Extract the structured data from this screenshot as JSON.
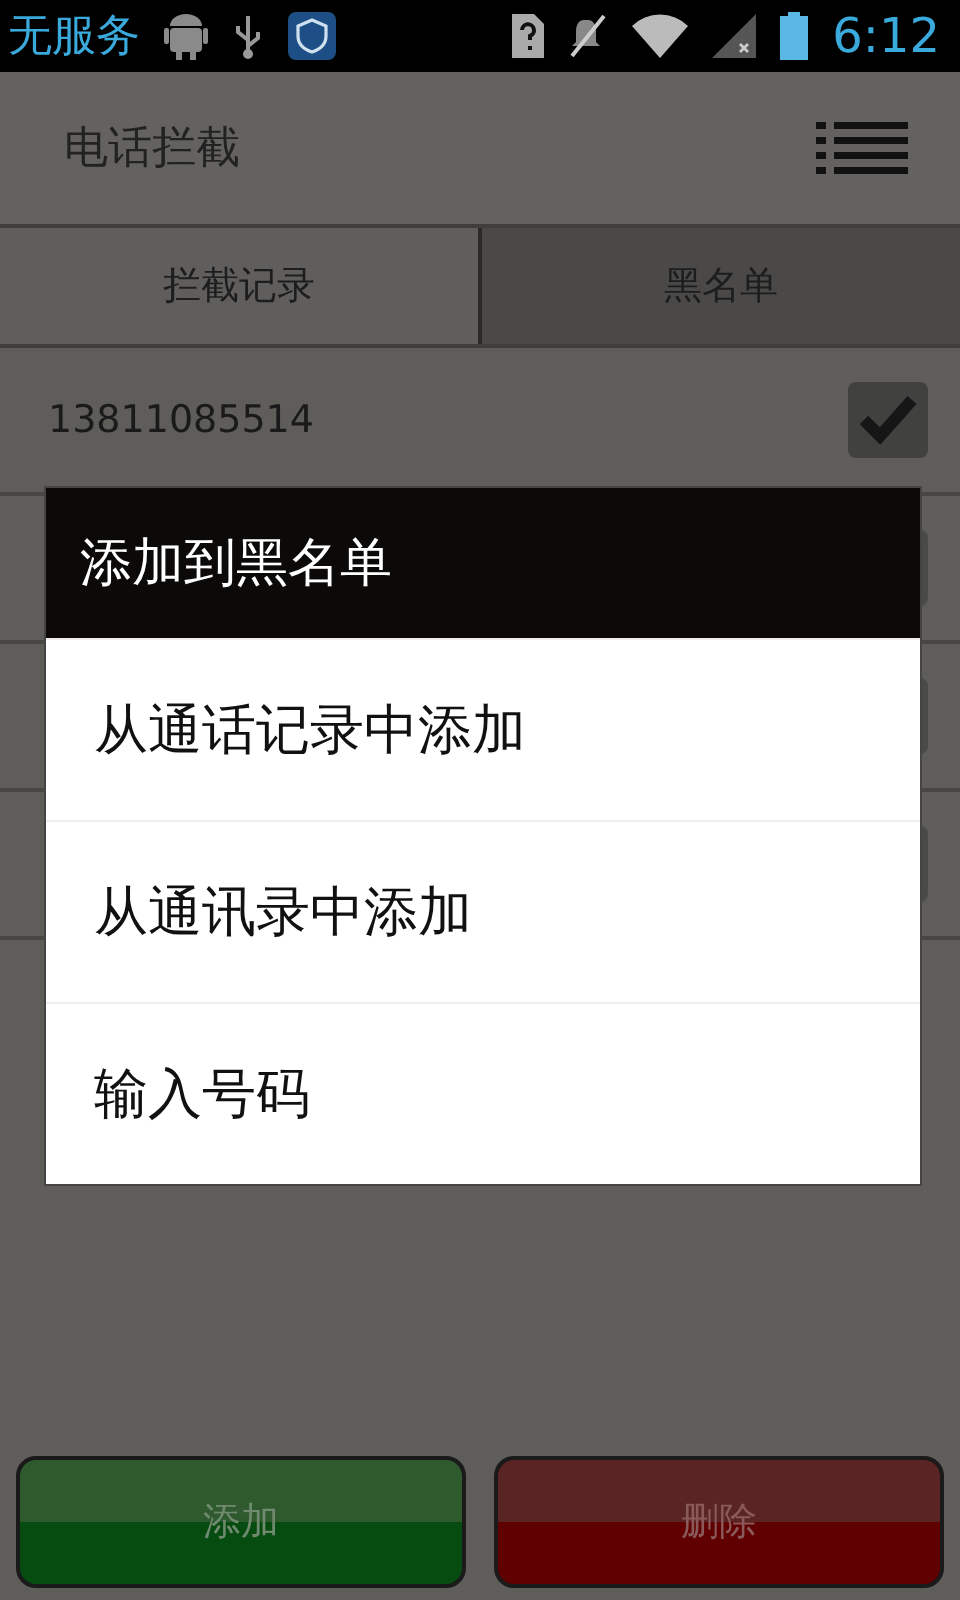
{
  "status_bar": {
    "carrier": "无服务",
    "time": "6:12"
  },
  "app_bar": {
    "title": "电话拦截"
  },
  "tabs": [
    {
      "label": "拦截记录",
      "selected": false
    },
    {
      "label": "黑名单",
      "selected": true
    }
  ],
  "rows": [
    {
      "number": "13811085514",
      "checked": true
    }
  ],
  "dialog": {
    "title": "添加到黑名单",
    "items": [
      "从通话记录中添加",
      "从通讯录中添加",
      "输入号码"
    ]
  },
  "buttons": [
    {
      "kind": "add",
      "label": "添加"
    },
    {
      "kind": "delete",
      "label": "删除"
    }
  ]
}
